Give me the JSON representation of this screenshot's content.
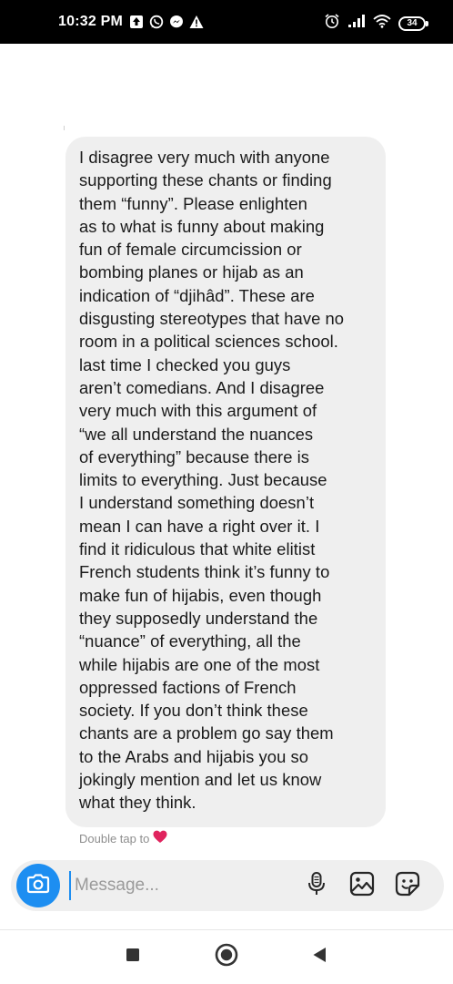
{
  "status_bar": {
    "time": "10:32 PM",
    "battery": "34",
    "left_icons": [
      "upload-notification-icon",
      "whatsapp-icon",
      "messenger-icon",
      "warning-icon"
    ],
    "right_icons": [
      "alarm-icon",
      "signal-icon",
      "wifi-icon",
      "battery-icon"
    ]
  },
  "message": {
    "text": "I disagree very much with anyone\nsupporting these chants or finding\nthem “funny”. Please enlighten\nas to what is funny about making\nfun of female circumcission or\nbombing planes or hijab as an\nindication of “djihâd”. These are\ndisgusting stereotypes that have no\nroom in a political sciences school.\nlast time I checked you guys\naren’t comedians. And I disagree\nvery much with this argument of\n“we all understand the nuances\nof everything” because there is\nlimits to everything. Just because\nI understand something doesn’t\nmean I can have a right over it. I\nfind it ridiculous that white elitist\nFrench students think it’s funny to\nmake fun of hijabis, even though\nthey supposedly understand the\n“nuance” of everything, all the\nwhile hijabis are one of the most\noppressed factions of French\nsociety. If you don’t think these\nchants are a problem go say them\nto the Arabs and hijabis you so\njokingly mention and let us know\nwhat they think.",
    "reaction_hint": "Double tap to",
    "reaction_icon": "heart-icon"
  },
  "composer": {
    "placeholder": "Message...",
    "value": "",
    "icons": [
      "camera-icon",
      "microphone-icon",
      "gallery-icon",
      "sticker-icon"
    ]
  },
  "nav_bar": {
    "buttons": [
      "recents-square-icon",
      "home-circle-icon",
      "back-triangle-icon"
    ]
  },
  "colors": {
    "accent": "#1d8ef1",
    "bubble": "#efefef",
    "heart": "#e0245e"
  }
}
